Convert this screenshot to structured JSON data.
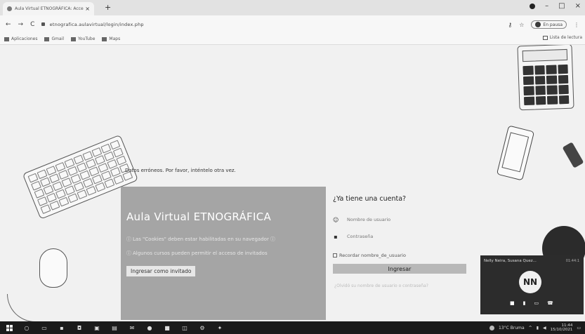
{
  "browser": {
    "tab_title": "Aula Virtual ETNOGRÁFICA: Acce",
    "tab_close": "×",
    "new_tab": "+",
    "back": "←",
    "forward": "→",
    "reload": "C",
    "url": "etnografica.aulavirtual/login/index.php",
    "profile_label": "En pausa",
    "bookmarks": [
      "Aplicaciones",
      "Gmail",
      "YouTube",
      "Maps"
    ],
    "reading_list": "Lista de lectura",
    "window_controls": [
      "–",
      "□",
      "×"
    ]
  },
  "page": {
    "error_message": "Datos erróneos. Por favor, inténtelo otra vez.",
    "left_card": {
      "title": "Aula Virtual ETNOGRÁFICA",
      "cookies_notice": "Las \"Cookies\" deben estar habilitadas en su navegador",
      "guest_notice": "Algunos cursos pueden permitir el acceso de invitados",
      "guest_button": "Ingresar como invitado"
    },
    "right_card": {
      "heading": "¿Ya tiene una cuenta?",
      "username_placeholder": "Nombre de usuario",
      "password_placeholder": "Contraseña",
      "remember_label": "Recordar nombre_de_usuario",
      "login_button": "Ingresar",
      "forgot_link": "¿Olvidó su nombre de usuario o contraseña?"
    }
  },
  "video_call": {
    "participants": "Nelly Neira, Susana Quez...",
    "duration": "01:44:1",
    "avatar_initials": "NN"
  },
  "taskbar": {
    "weather": "13°C Bruma",
    "time": "11:44",
    "date": "15/10/2021"
  }
}
